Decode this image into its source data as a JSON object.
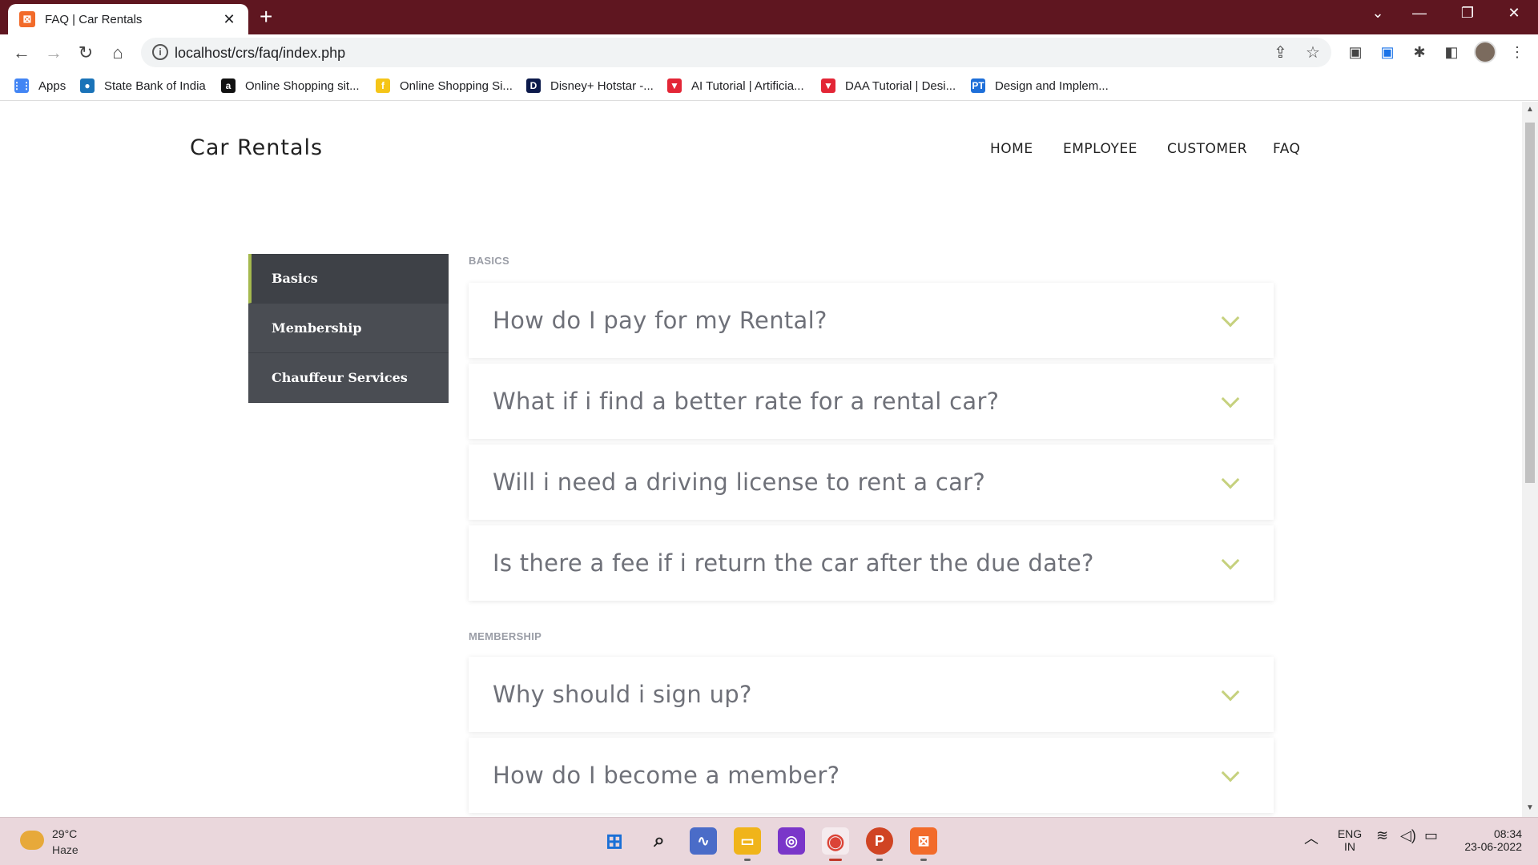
{
  "browser": {
    "tab_title": "FAQ | Car Rentals",
    "tab_close": "✕",
    "new_tab": "+",
    "url": "localhost/crs/faq/index.php",
    "bookmarks": [
      {
        "label": "Apps",
        "icon": "apps-grid-icon",
        "color": "#4285f4",
        "glyph": "⋮⋮"
      },
      {
        "label": "State Bank of India",
        "icon": "sbi-icon",
        "color": "#1a73b8",
        "glyph": "●"
      },
      {
        "label": "Online Shopping sit...",
        "icon": "amazon-icon",
        "color": "#111111",
        "glyph": "a"
      },
      {
        "label": "Online Shopping Si...",
        "icon": "flipkart-icon",
        "color": "#f5c518",
        "glyph": "f"
      },
      {
        "label": "Disney+ Hotstar -...",
        "icon": "hotstar-icon",
        "color": "#0c1a4b",
        "glyph": "D"
      },
      {
        "label": "AI Tutorial | Artificia...",
        "icon": "javatpoint-icon",
        "color": "#e32636",
        "glyph": "▼"
      },
      {
        "label": "DAA Tutorial | Desi...",
        "icon": "javatpoint-icon",
        "color": "#e32636",
        "glyph": "▼"
      },
      {
        "label": "Design and Implem...",
        "icon": "pt-icon",
        "color": "#1e6fd9",
        "glyph": "PT"
      }
    ]
  },
  "site": {
    "brand": "Car Rentals",
    "nav": [
      "HOME",
      "EMPLOYEE",
      "CUSTOMER",
      "FAQ"
    ]
  },
  "sidebar": {
    "items": [
      {
        "label": "Basics",
        "active": true
      },
      {
        "label": "Membership",
        "active": false
      },
      {
        "label": "Chauffeur Services",
        "active": false
      }
    ]
  },
  "faq": {
    "sections": [
      {
        "label": "BASICS",
        "questions": [
          "How do I pay for my Rental?",
          "What if i find a better rate for a rental car?",
          "Will i need a driving license to rent a car?",
          "Is there a fee if i return the car after the due date?"
        ]
      },
      {
        "label": "MEMBERSHIP",
        "questions": [
          "Why should i sign up?",
          "How do I become a member?"
        ]
      }
    ]
  },
  "taskbar": {
    "weather_temp": "29°C",
    "weather_cond": "Haze",
    "lang_top": "ENG",
    "lang_bottom": "IN",
    "time": "08:34",
    "date": "23-06-2022"
  },
  "colors": {
    "titlebar": "#5f1620",
    "sidebar": "#4a4d53",
    "accent": "#a5b94e",
    "chevron": "#c6d17e"
  }
}
